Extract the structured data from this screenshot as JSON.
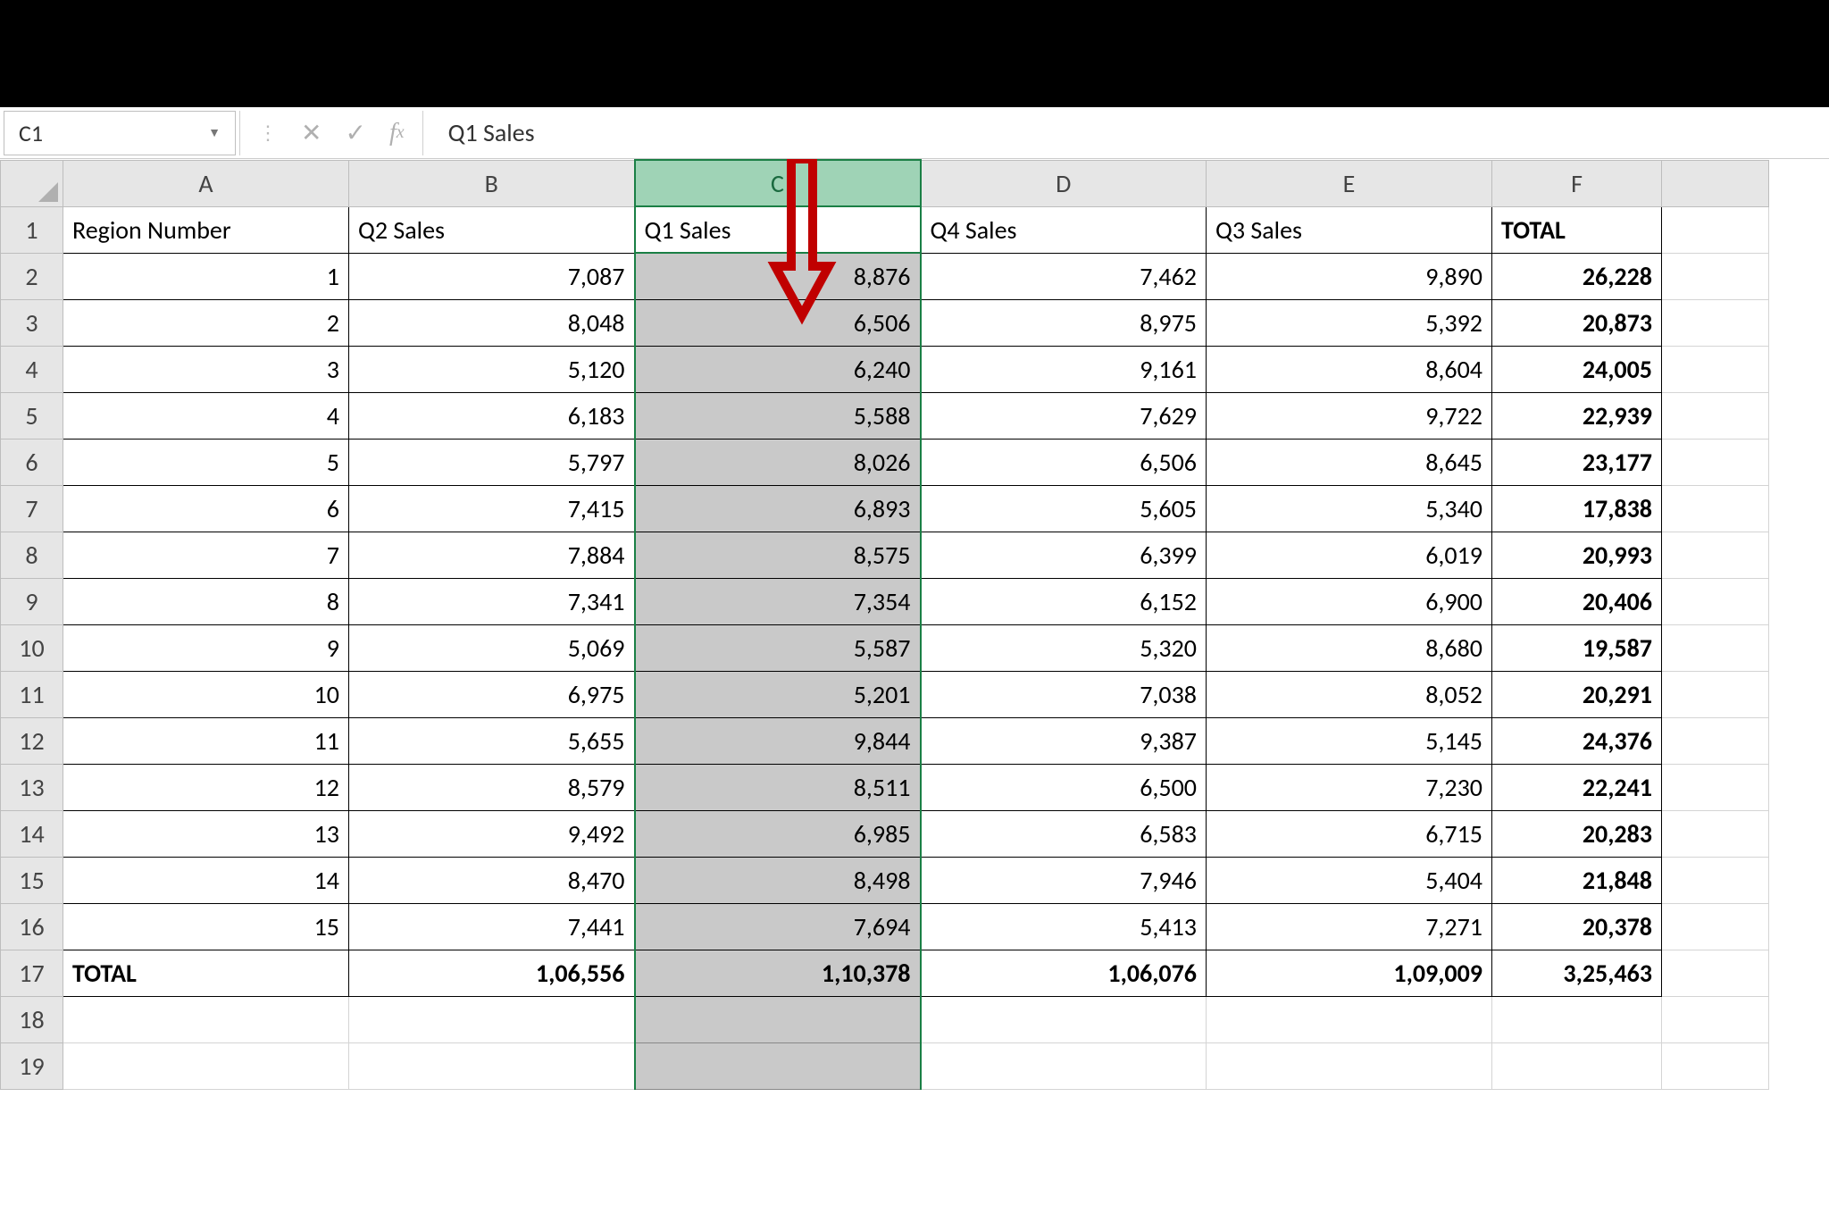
{
  "namebox": {
    "ref": "C1"
  },
  "formula": {
    "text": "Q1 Sales"
  },
  "columns": [
    "A",
    "B",
    "C",
    "D",
    "E",
    "F"
  ],
  "rowHeaders": [
    "1",
    "2",
    "3",
    "4",
    "5",
    "6",
    "7",
    "8",
    "9",
    "10",
    "11",
    "12",
    "13",
    "14",
    "15",
    "16",
    "17",
    "18",
    "19"
  ],
  "headers": {
    "A": "Region Number",
    "B": "Q2 Sales",
    "C": "Q1 Sales",
    "D": "Q4 Sales",
    "E": "Q3 Sales",
    "F": "TOTAL"
  },
  "rows": [
    {
      "A": "1",
      "B": "7,087",
      "C": "8,876",
      "D": "7,462",
      "E": "9,890",
      "F": "26,228"
    },
    {
      "A": "2",
      "B": "8,048",
      "C": "6,506",
      "D": "8,975",
      "E": "5,392",
      "F": "20,873"
    },
    {
      "A": "3",
      "B": "5,120",
      "C": "6,240",
      "D": "9,161",
      "E": "8,604",
      "F": "24,005"
    },
    {
      "A": "4",
      "B": "6,183",
      "C": "5,588",
      "D": "7,629",
      "E": "9,722",
      "F": "22,939"
    },
    {
      "A": "5",
      "B": "5,797",
      "C": "8,026",
      "D": "6,506",
      "E": "8,645",
      "F": "23,177"
    },
    {
      "A": "6",
      "B": "7,415",
      "C": "6,893",
      "D": "5,605",
      "E": "5,340",
      "F": "17,838"
    },
    {
      "A": "7",
      "B": "7,884",
      "C": "8,575",
      "D": "6,399",
      "E": "6,019",
      "F": "20,993"
    },
    {
      "A": "8",
      "B": "7,341",
      "C": "7,354",
      "D": "6,152",
      "E": "6,900",
      "F": "20,406"
    },
    {
      "A": "9",
      "B": "5,069",
      "C": "5,587",
      "D": "5,320",
      "E": "8,680",
      "F": "19,587"
    },
    {
      "A": "10",
      "B": "6,975",
      "C": "5,201",
      "D": "7,038",
      "E": "8,052",
      "F": "20,291"
    },
    {
      "A": "11",
      "B": "5,655",
      "C": "9,844",
      "D": "9,387",
      "E": "5,145",
      "F": "24,376"
    },
    {
      "A": "12",
      "B": "8,579",
      "C": "8,511",
      "D": "6,500",
      "E": "7,230",
      "F": "22,241"
    },
    {
      "A": "13",
      "B": "9,492",
      "C": "6,985",
      "D": "6,583",
      "E": "6,715",
      "F": "20,283"
    },
    {
      "A": "14",
      "B": "8,470",
      "C": "8,498",
      "D": "7,946",
      "E": "5,404",
      "F": "21,848"
    },
    {
      "A": "15",
      "B": "7,441",
      "C": "7,694",
      "D": "5,413",
      "E": "7,271",
      "F": "20,378"
    }
  ],
  "total": {
    "label": "TOTAL",
    "B": "1,06,556",
    "C": "1,10,378",
    "D": "1,06,076",
    "E": "1,09,009",
    "F": "3,25,463"
  },
  "selected_column": "C"
}
